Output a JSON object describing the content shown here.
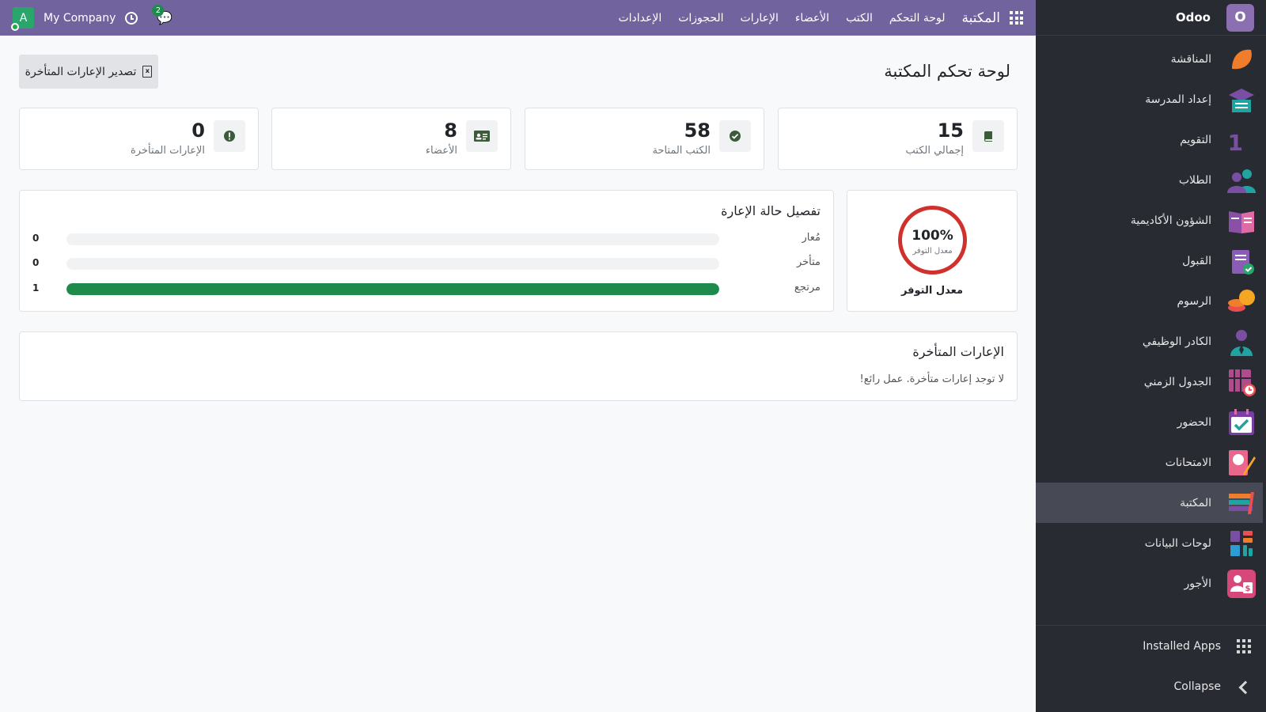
{
  "topbar": {
    "avatar_letter": "A",
    "company": "My Company",
    "chat_badge": "2",
    "brand": "المكتبة",
    "nav": [
      "لوحة التحكم",
      "الكتب",
      "الأعضاء",
      "الإعارات",
      "الحجوزات",
      "الإعدادات"
    ]
  },
  "sidebar": {
    "app_letter": "O",
    "app_name": "Odoo",
    "items": [
      {
        "label": "المناقشة",
        "icon": "discussion-icon",
        "color": "#f07d2b"
      },
      {
        "label": "إعداد المدرسة",
        "icon": "school-setup-icon",
        "color": "#7a4fa3"
      },
      {
        "label": "التقويم",
        "icon": "calendar-icon",
        "color": "#ec8e2c"
      },
      {
        "label": "الطلاب",
        "icon": "students-icon",
        "color": "#1fa4a1"
      },
      {
        "label": "الشؤون الأكاديمية",
        "icon": "academics-icon",
        "color": "#8b4fa8"
      },
      {
        "label": "القبول",
        "icon": "admission-icon",
        "color": "#8b5cb5"
      },
      {
        "label": "الرسوم",
        "icon": "fees-icon",
        "color": "#f5a623"
      },
      {
        "label": "الكادر الوظيفي",
        "icon": "staff-icon",
        "color": "#1fa4a1"
      },
      {
        "label": "الجدول الزمني",
        "icon": "timetable-icon",
        "color": "#b24a8e"
      },
      {
        "label": "الحضور",
        "icon": "attendance-icon",
        "color": "#7a3fa0"
      },
      {
        "label": "الامتحانات",
        "icon": "exams-icon",
        "color": "#e8678a"
      },
      {
        "label": "المكتبة",
        "icon": "library-icon",
        "color": "#e94f4f"
      },
      {
        "label": "لوحات البيانات",
        "icon": "dashboards-icon",
        "color": "#2d9bd4"
      },
      {
        "label": "الأجور",
        "icon": "payroll-icon",
        "color": "#d6487a"
      }
    ],
    "installed_apps": "Installed Apps",
    "collapse": "Collapse"
  },
  "page": {
    "title": "لوحة تحكم المكتبة",
    "export_button": "تصدير الإعارات المتأخرة"
  },
  "stats": [
    {
      "value": "15",
      "label": "إجمالي الكتب",
      "icon": "book-icon"
    },
    {
      "value": "58",
      "label": "الكتب المتاحة",
      "icon": "check-circle-icon"
    },
    {
      "value": "8",
      "label": "الأعضاء",
      "icon": "id-card-icon"
    },
    {
      "value": "0",
      "label": "الإعارات المتأخرة",
      "icon": "alert-icon"
    }
  ],
  "availability": {
    "value": "100%",
    "sub": "معدل التوفر",
    "title": "معدل التوفر",
    "ring_color": "#d0312d"
  },
  "loan_status": {
    "title": "تفصيل حالة الإعارة",
    "rows": [
      {
        "label": "مُعار",
        "count": "0",
        "fraction": 0
      },
      {
        "label": "متأخر",
        "count": "0",
        "fraction": 0
      },
      {
        "label": "مرتجع",
        "count": "1",
        "fraction": 1
      }
    ],
    "bar_color": "#1e8a4c"
  },
  "overdue": {
    "title": "الإعارات المتأخرة",
    "message": "لا توجد إعارات متأخرة. عمل رائع!"
  }
}
